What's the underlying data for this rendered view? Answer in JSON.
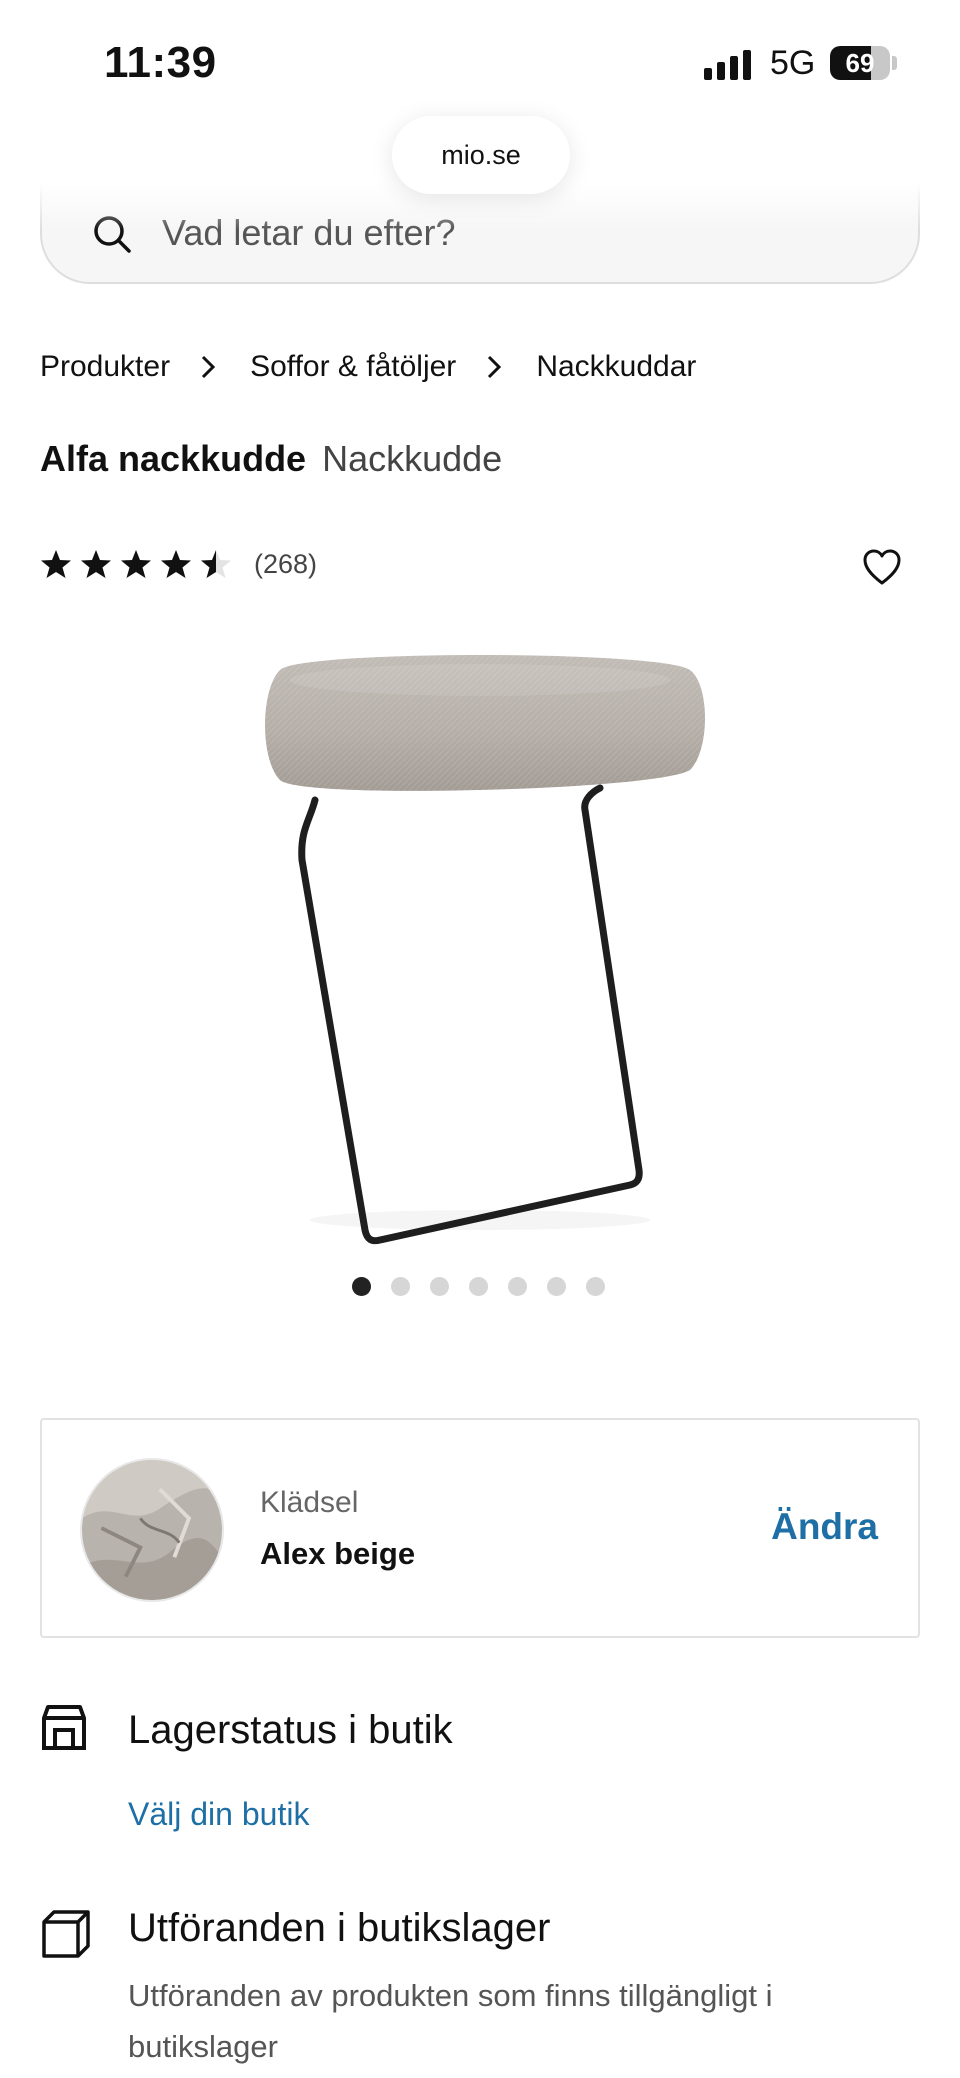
{
  "status_bar": {
    "time": "11:39",
    "network": "5G",
    "battery": "69",
    "battery_level": 0.69
  },
  "browser": {
    "url": "mio.se"
  },
  "search": {
    "placeholder": "Vad letar du efter?"
  },
  "breadcrumb": [
    "Produkter",
    "Soffor & fåtöljer",
    "Nackkuddar"
  ],
  "product": {
    "name": "Alfa nackkudde",
    "type": "Nackkudde",
    "rating": 4.5,
    "review_count": "(268)",
    "image_count": 7,
    "active_image": 1
  },
  "upholstery": {
    "label": "Klädsel",
    "value": "Alex beige",
    "action": "Ändra"
  },
  "store_stock": {
    "title": "Lagerstatus i butik",
    "link": "Välj din butik"
  },
  "variants": {
    "title": "Utföranden i butikslager",
    "description": "Utföranden av produkten som finns tillgängligt i butikslager"
  },
  "colors": {
    "link": "#1d6fa5",
    "text": "#111111",
    "fabric": "#b7b1ab",
    "frame": "#1e1e1e"
  },
  "icons": [
    "search-icon",
    "chevron-right-icon",
    "star-icon",
    "heart-icon",
    "store-icon",
    "box-icon"
  ]
}
